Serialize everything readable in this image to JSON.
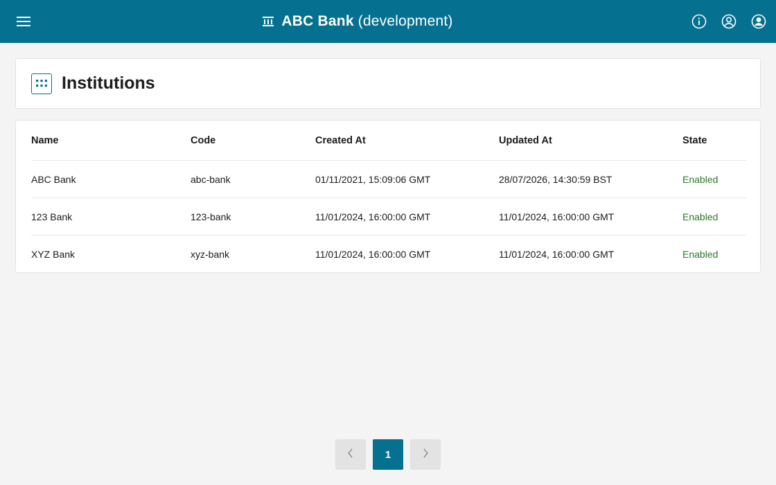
{
  "header": {
    "bank_name": "ABC Bank",
    "environment": "(development)",
    "icons": [
      "menu-icon",
      "bank-icon",
      "info-icon",
      "account-circle-icon",
      "user-profile-icon"
    ],
    "background_color": "#05708f"
  },
  "page": {
    "title": "Institutions",
    "title_icon": "apps-grid-icon"
  },
  "table": {
    "columns": [
      "Name",
      "Code",
      "Created At",
      "Updated At",
      "State"
    ],
    "rows": [
      {
        "name": "ABC Bank",
        "code": "abc-bank",
        "created_at": "01/11/2021, 15:09:06 GMT",
        "updated_at": "28/07/2026, 14:30:59 BST",
        "state": "Enabled"
      },
      {
        "name": "123 Bank",
        "code": "123-bank",
        "created_at": "11/01/2024, 16:00:00 GMT",
        "updated_at": "11/01/2024, 16:00:00 GMT",
        "state": "Enabled"
      },
      {
        "name": "XYZ Bank",
        "code": "xyz-bank",
        "created_at": "11/01/2024, 16:00:00 GMT",
        "updated_at": "11/01/2024, 16:00:00 GMT",
        "state": "Enabled"
      }
    ],
    "state_color": "#2a7a2a"
  },
  "pagination": {
    "current_page": "1",
    "prev_icon": "chevron-left-icon",
    "next_icon": "chevron-right-icon"
  }
}
